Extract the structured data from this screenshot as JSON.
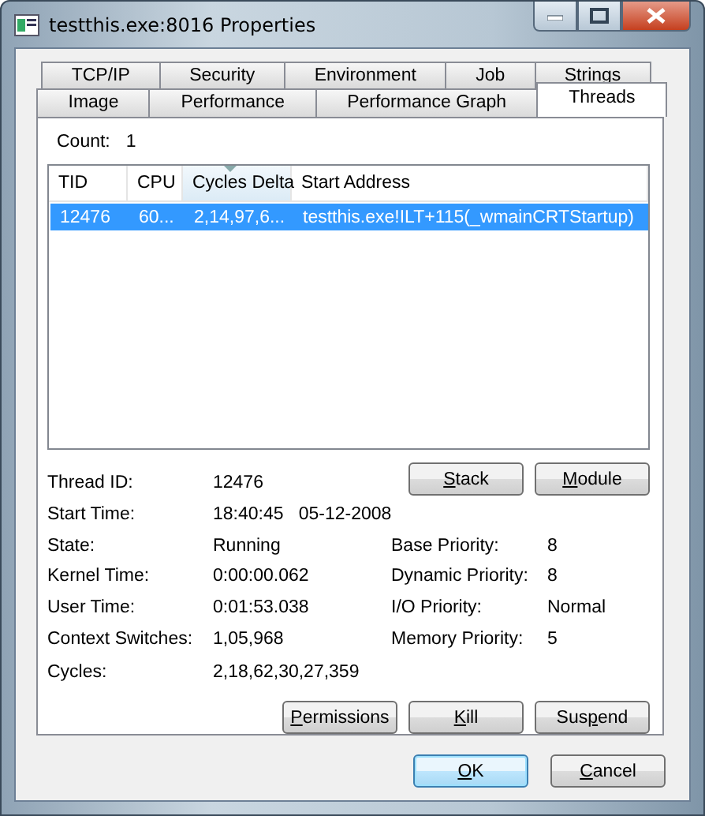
{
  "window": {
    "title": "testthis.exe:8016 Properties"
  },
  "tab_rows": [
    [
      {
        "label": "TCP/IP",
        "selected": false
      },
      {
        "label": "Security",
        "selected": false
      },
      {
        "label": "Environment",
        "selected": false
      },
      {
        "label": "Job",
        "selected": false
      },
      {
        "label": "Strings",
        "selected": false
      }
    ],
    [
      {
        "label": "Image",
        "selected": false
      },
      {
        "label": "Performance",
        "selected": false
      },
      {
        "label": "Performance Graph",
        "selected": false
      },
      {
        "label": "Threads",
        "selected": true
      }
    ]
  ],
  "count": {
    "label": "Count:",
    "value": "1"
  },
  "table": {
    "columns": [
      {
        "label": "TID",
        "sorted": false
      },
      {
        "label": "CPU",
        "sorted": false
      },
      {
        "label": "Cycles Delta",
        "sorted": true
      },
      {
        "label": "Start Address",
        "sorted": false
      }
    ],
    "rows": [
      {
        "cells": [
          "12476",
          "60...",
          "2,14,97,6...",
          "testthis.exe!ILT+115(_wmainCRTStartup)"
        ],
        "selected": true
      }
    ]
  },
  "thread_info": [
    {
      "label": "Thread ID:",
      "value": "12476"
    },
    {
      "label": "Start Time:",
      "value": "18:40:45   05-12-2008"
    }
  ],
  "top_buttons": [
    {
      "key": "S",
      "after": "tack"
    },
    {
      "key": "M",
      "after": "odule"
    }
  ],
  "details": [
    {
      "left": {
        "label": "State:",
        "value": "Running"
      },
      "right": {
        "label": "Base Priority:",
        "value": "8"
      }
    },
    {
      "left": {
        "label": "Kernel Time:",
        "value": "0:00:00.062"
      },
      "right": {
        "label": "Dynamic Priority:",
        "value": "8"
      }
    },
    {
      "left": {
        "label": "User Time:",
        "value": "0:01:53.038"
      },
      "right": {
        "label": "I/O Priority:",
        "value": "Normal"
      }
    },
    {
      "left": {
        "label": "Context Switches:",
        "value": "1,05,968"
      },
      "right": {
        "label": "Memory Priority:",
        "value": "5"
      }
    },
    {
      "left": {
        "label": "Cycles:",
        "value": "2,18,62,30,27,359"
      }
    }
  ],
  "thread_buttons": [
    {
      "key": "P",
      "after": "ermissions"
    },
    {
      "key": "K",
      "after": "ill"
    },
    {
      "before": "Sus",
      "key": "p",
      "after": "end"
    }
  ],
  "dialog_buttons": [
    {
      "key": "O",
      "after": "K",
      "default": true
    },
    {
      "key": "C",
      "after": "ancel",
      "default": false
    }
  ]
}
